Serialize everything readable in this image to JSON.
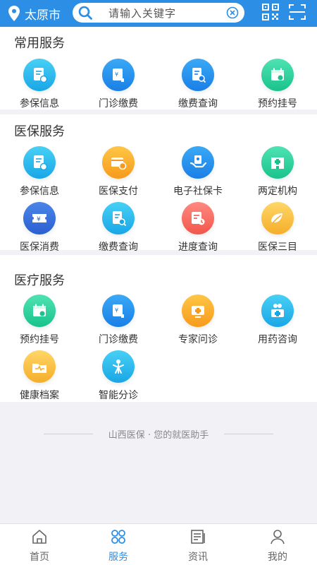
{
  "header": {
    "city": "太原市",
    "search_placeholder": "请输入关键字"
  },
  "sections": [
    {
      "title": "常用服务",
      "items": [
        {
          "label": "参保信息",
          "icon": "document-icon",
          "color": "#19a6e6"
        },
        {
          "label": "门诊缴费",
          "icon": "payment-icon",
          "color": "#1a7fe6"
        },
        {
          "label": "缴费查询",
          "icon": "receipt-search-icon",
          "color": "#1a7fe6"
        },
        {
          "label": "预约挂号",
          "icon": "calendar-icon",
          "color": "#19c28c"
        }
      ]
    },
    {
      "title": "医保服务",
      "items": [
        {
          "label": "参保信息",
          "icon": "document-icon",
          "color": "#19a6e6"
        },
        {
          "label": "医保支付",
          "icon": "card-payment-icon",
          "color": "#f79a1c"
        },
        {
          "label": "电子社保卡",
          "icon": "hand-card-icon",
          "color": "#1a7fe6"
        },
        {
          "label": "两定机构",
          "icon": "hospital-icon",
          "color": "#19c28c"
        },
        {
          "label": "医保消费",
          "icon": "ticket-icon",
          "color": "#2b5fd0"
        },
        {
          "label": "缴费查询",
          "icon": "receipt-search-icon",
          "color": "#19a6e6"
        },
        {
          "label": "进度查询",
          "icon": "progress-icon",
          "color": "#f2564b"
        },
        {
          "label": "医保三目",
          "icon": "leaf-icon",
          "color": "#f5ae2a"
        }
      ]
    },
    {
      "title": "医疗服务",
      "items": [
        {
          "label": "预约挂号",
          "icon": "calendar-icon",
          "color": "#19c28c"
        },
        {
          "label": "门诊缴费",
          "icon": "payment-icon",
          "color": "#1a7fe6"
        },
        {
          "label": "专家问诊",
          "icon": "doctor-icon",
          "color": "#f79a1c"
        },
        {
          "label": "用药咨询",
          "icon": "medicine-icon",
          "color": "#19a6e6"
        },
        {
          "label": "健康档案",
          "icon": "health-record-icon",
          "color": "#f5ae2a"
        },
        {
          "label": "智能分诊",
          "icon": "triage-icon",
          "color": "#19a6e6"
        }
      ]
    }
  ],
  "slogan": "山西医保 · 您的就医助手",
  "tabs": [
    {
      "label": "首页",
      "icon": "home-icon",
      "active": false
    },
    {
      "label": "服务",
      "icon": "services-icon",
      "active": true
    },
    {
      "label": "资讯",
      "icon": "news-icon",
      "active": false
    },
    {
      "label": "我的",
      "icon": "profile-icon",
      "active": false
    }
  ],
  "colors": {
    "primary": "#2d8ee6",
    "background": "#f2f2f6",
    "tab_active": "#2d8ee6",
    "tab_inactive": "#666666"
  }
}
